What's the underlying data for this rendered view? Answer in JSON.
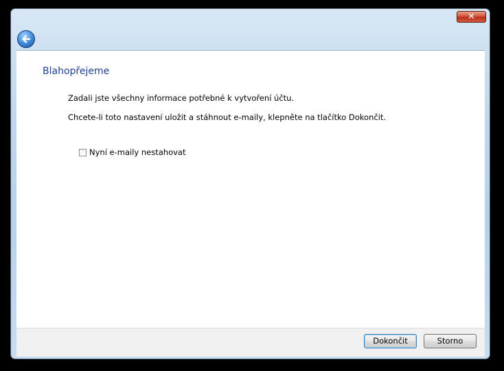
{
  "window": {
    "close_symbol": "✕",
    "back_icon": "back-arrow-icon"
  },
  "main": {
    "heading": "Blahopřejeme",
    "line1": "Zadali jste všechny informace potřebné k vytvoření účtu.",
    "line2": "Chcete-li toto nastavení uložit a stáhnout e-maily, klepněte na tlačítko Dokončit.",
    "checkbox_label": "Nyní e-maily nestahovat",
    "checkbox_checked": false
  },
  "footer": {
    "finish_label": "Dokončit",
    "cancel_label": "Storno"
  }
}
